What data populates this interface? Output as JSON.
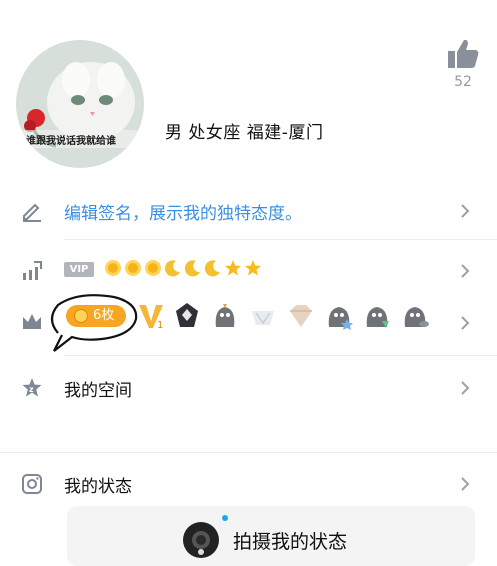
{
  "profile": {
    "avatar_caption": "谁跟我说话我就给谁",
    "info": "男  处女座  福建-厦门",
    "like_count": "52"
  },
  "rows": {
    "signature": {
      "label": "编辑签名，展示我的独特态度。"
    },
    "vip": {
      "tag": "VIP",
      "levels": [
        "sun",
        "sun",
        "sun",
        "moon",
        "moon",
        "moon",
        "star",
        "star"
      ]
    },
    "badges": {
      "count_label": "6枚",
      "items": [
        "vip-badge",
        "medal-badge",
        "rocket-badge",
        "crown-badge",
        "gem-badge",
        "penguin-badge",
        "penguin-star-badge",
        "penguin-gem-badge",
        "penguin-fish-badge"
      ]
    },
    "space": {
      "label": "我的空间"
    },
    "status": {
      "label": "我的状态"
    }
  },
  "status_card": {
    "capture_label": "拍摄我的状态"
  },
  "colors": {
    "accent": "#3b8fe0",
    "badge_pill": "#f6a623",
    "icon_grey": "#7f8694"
  }
}
